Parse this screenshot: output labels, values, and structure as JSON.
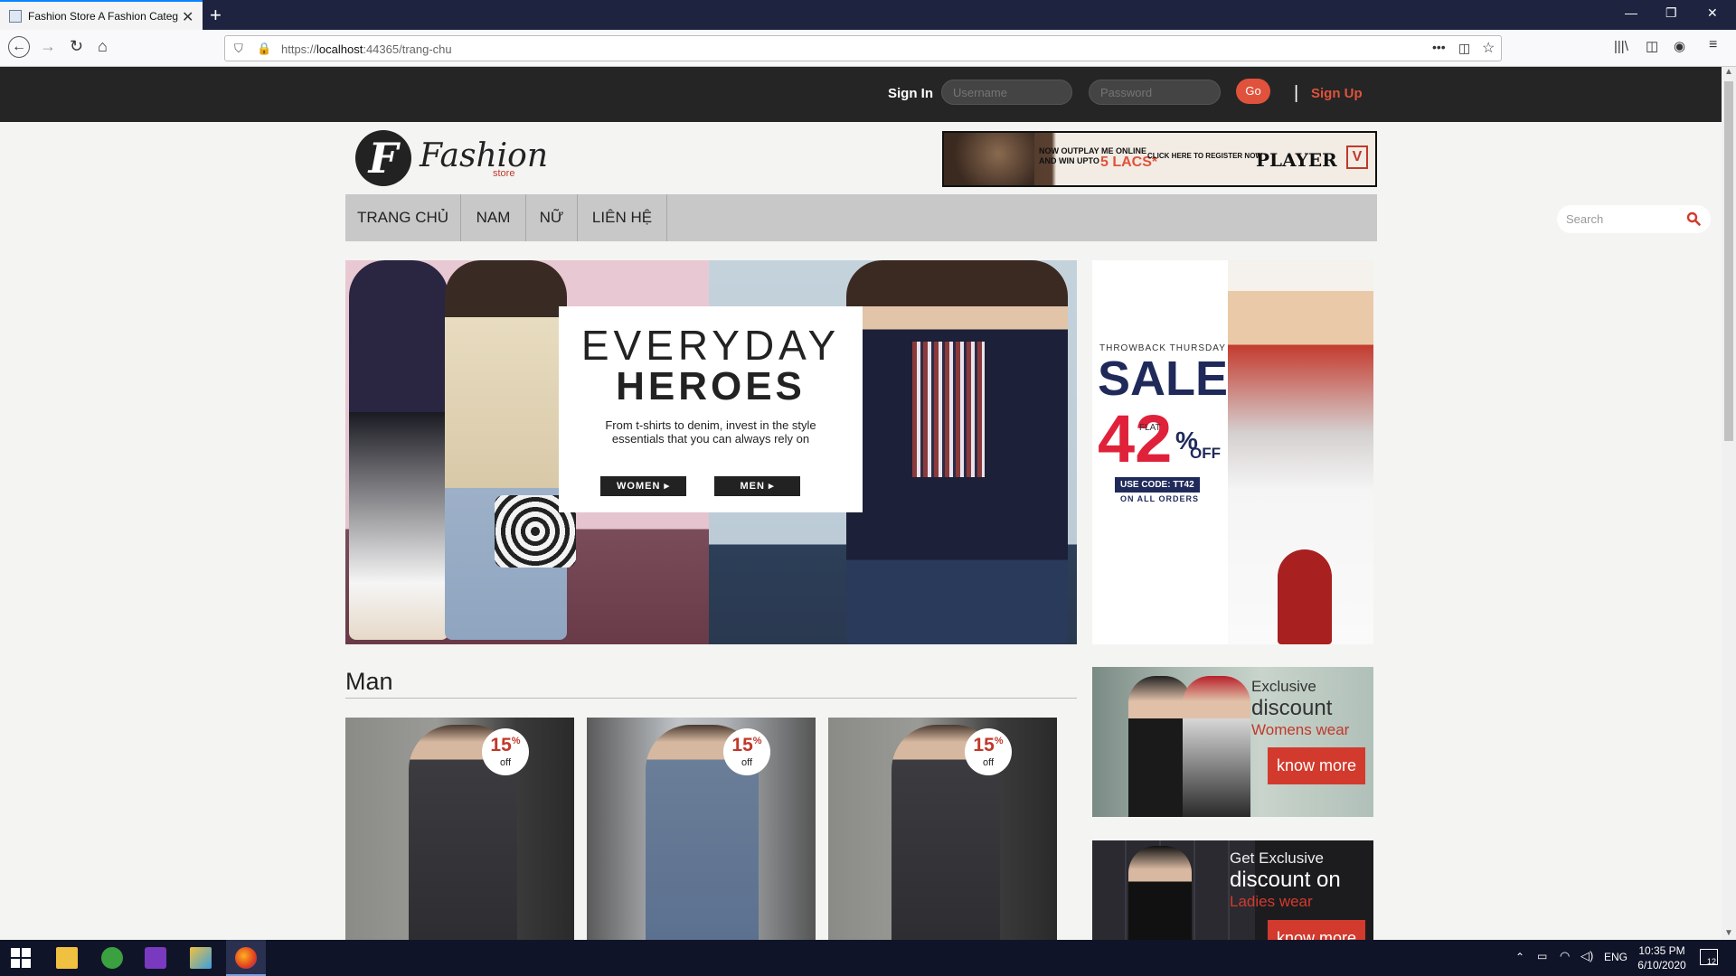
{
  "browser": {
    "tab_title": "Fashion Store A Fashion Categ",
    "url_prefix": "https://",
    "url_host": "localhost",
    "url_rest": ":44365/trang-chu"
  },
  "topbar": {
    "signin_label": "Sign In",
    "username_placeholder": "Username",
    "password_placeholder": "Password",
    "go_label": "Go",
    "separator": "|",
    "signup_label": "Sign Up"
  },
  "logo": {
    "letter": "F",
    "name": "Fashion",
    "sub": "store"
  },
  "ad_banner": {
    "line1": "NOW OUTPLAY ME ONLINE",
    "line1b": "AND WIN UPTO",
    "amount": "5 LACS*",
    "register": "CLICK HERE TO REGISTER NOW",
    "brand": "PLAYER"
  },
  "menu": {
    "items": [
      "TRANG CHỦ",
      "NAM",
      "NỮ",
      "LIÊN HỆ"
    ],
    "search_placeholder": "Search"
  },
  "hero": {
    "title1": "EVERYDAY",
    "title2": "HEROES",
    "text": "From t-shirts to denim, invest in the style essentials that you can always rely on",
    "women_btn": "WOMEN ▸",
    "men_btn": "MEN ▸"
  },
  "sale": {
    "throwback": "THROWBACK THURSDAY",
    "sale": "SALE",
    "flat": "FLAT",
    "number": "42",
    "percent": "%",
    "off": "OFF",
    "code": "USE CODE: TT42",
    "orders": "ON ALL ORDERS"
  },
  "man_section": {
    "title": "Man",
    "products": [
      {
        "discount": "15",
        "unit": "%",
        "off": "off"
      },
      {
        "discount": "15",
        "unit": "%",
        "off": "off"
      },
      {
        "discount": "15",
        "unit": "%",
        "off": "off"
      }
    ]
  },
  "promo1": {
    "line1": "Exclusive",
    "line2": "discount",
    "line3": "Womens wear",
    "button": "know more"
  },
  "promo2": {
    "line1": "Get Exclusive",
    "line2": "discount on",
    "line3": "Ladies wear",
    "button": "know more"
  },
  "taskbar": {
    "lang": "ENG",
    "time": "10:35 PM",
    "date": "6/10/2020",
    "notifications": "12"
  }
}
